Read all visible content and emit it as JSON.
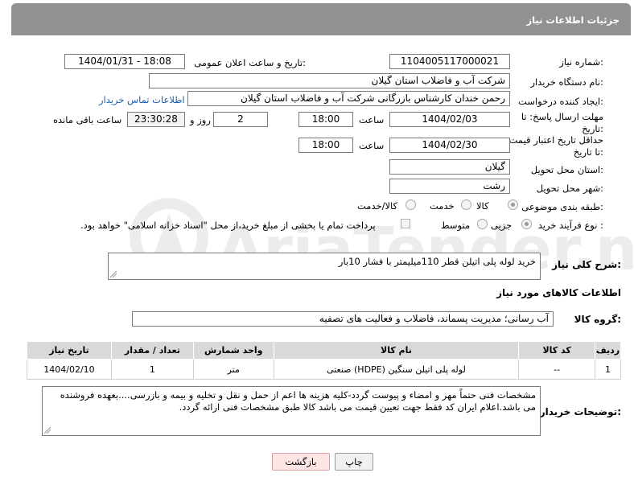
{
  "header": {
    "title": "جزئیات اطلاعات نیاز"
  },
  "fields": {
    "need_number_label": "شماره نیاز:",
    "need_number": "1104005117000021",
    "announce_label": "تاریخ و ساعت اعلان عمومی:",
    "announce_value": "1404/01/31 - 18:08",
    "buyer_org_label": "نام دستگاه خریدار:",
    "buyer_org": "شرکت آب و فاضلاب استان گیلان",
    "creator_label": "ایجاد کننده درخواست:",
    "creator": "رحمن خندان کارشناس بازرگانی شرکت آب و فاضلاب استان گیلان",
    "contact_link": "اطلاعات تماس خریدار",
    "deadline_label": "مهلت ارسال پاسخ: تا تاریخ:",
    "deadline_date": "1404/02/03",
    "time_label": "ساعت",
    "deadline_time": "18:00",
    "days_value": "2",
    "days_label": "روز و",
    "remaining_time": "23:30:28",
    "remaining_label": "ساعت باقی مانده",
    "price_validity_label": "حداقل تاریخ اعتبار قیمت: تا تاریخ:",
    "price_date": "1404/02/30",
    "price_time": "18:00",
    "province_label": "استان محل تحویل:",
    "province": "گیلان",
    "city_label": "شهر محل تحویل:",
    "city": "رشت",
    "category_label": "طبقه بندی موضوعی:",
    "category_options": [
      "کالا",
      "خدمت",
      "کالا/خدمت"
    ],
    "process_label": "نوع فرآیند خرید :",
    "process_options": [
      "جزیی",
      "متوسط"
    ],
    "payment_note": "پرداخت تمام یا بخشی از مبلغ خرید،از محل \"اسناد خزانه اسلامی\" خواهد بود.",
    "summary_label": "شرح کلی نیاز:",
    "summary": "خرید لوله پلی اتیلن قطر 110میلیمتر با فشار 10بار",
    "items_info_title": "اطلاعات کالاهای مورد نیاز",
    "group_label": "گروه کالا:",
    "group_value": "آب رسانی؛ مدیریت پسماند، فاضلاب و فعالیت های تصفیه",
    "buyer_notes_label": "توضیحات خریدار:",
    "buyer_notes": "مشخصات فنی حتماً مهر و امضاء و پیوست گردد-کلیه هزینه ها اعم از حمل و نقل و تخلیه و بیمه و بازرسی....بعهده فروشنده می باشد.اعلام ایران کد فقط جهت تعیین قیمت می باشد کالا طبق مشخصات فنی ارائه گردد."
  },
  "table": {
    "headers": [
      "ردیف",
      "کد کالا",
      "نام کالا",
      "واحد شمارش",
      "تعداد / مقدار",
      "تاریخ نیاز"
    ],
    "rows": [
      [
        "1",
        "--",
        "لوله پلی اتیلن سنگین (HDPE) صنعتی",
        "متر",
        "1",
        "1404/02/10"
      ]
    ]
  },
  "buttons": {
    "print": "چاپ",
    "back": "بازگشت"
  },
  "watermark": {
    "text": "AriaTender.neT"
  }
}
